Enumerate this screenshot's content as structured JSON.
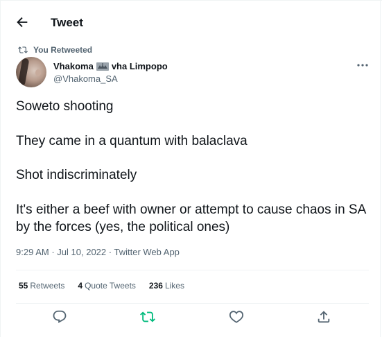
{
  "header": {
    "title": "Tweet"
  },
  "retweet_banner": {
    "text": "You Retweeted"
  },
  "author": {
    "name_part1": "Vhakoma",
    "name_part2": "vha Limpopo",
    "handle": "@Vhakoma_SA"
  },
  "tweet": {
    "paragraphs": [
      "Soweto shooting",
      "They came in a quantum with balaclava",
      "Shot indiscriminately",
      "It's either a beef with owner or attempt to cause chaos in SA by the forces (yes,  the political ones)"
    ],
    "time": "9:29 AM",
    "separator": "·",
    "date": "Jul 10, 2022",
    "source": "Twitter Web App"
  },
  "stats": {
    "retweets_count": "55",
    "retweets_label": "Retweets",
    "quotes_count": "4",
    "quotes_label": "Quote Tweets",
    "likes_count": "236",
    "likes_label": "Likes"
  },
  "colors": {
    "text": "#0f1419",
    "secondary": "#536471",
    "retweet_active": "#00ba7c",
    "divider": "#eff3f4"
  },
  "icons": {
    "back": "arrow-left-icon",
    "retweet_banner": "retweet-icon",
    "more": "more-horizontal-icon",
    "reply": "reply-icon",
    "retweet": "retweet-icon",
    "like": "heart-icon",
    "share": "share-icon"
  }
}
